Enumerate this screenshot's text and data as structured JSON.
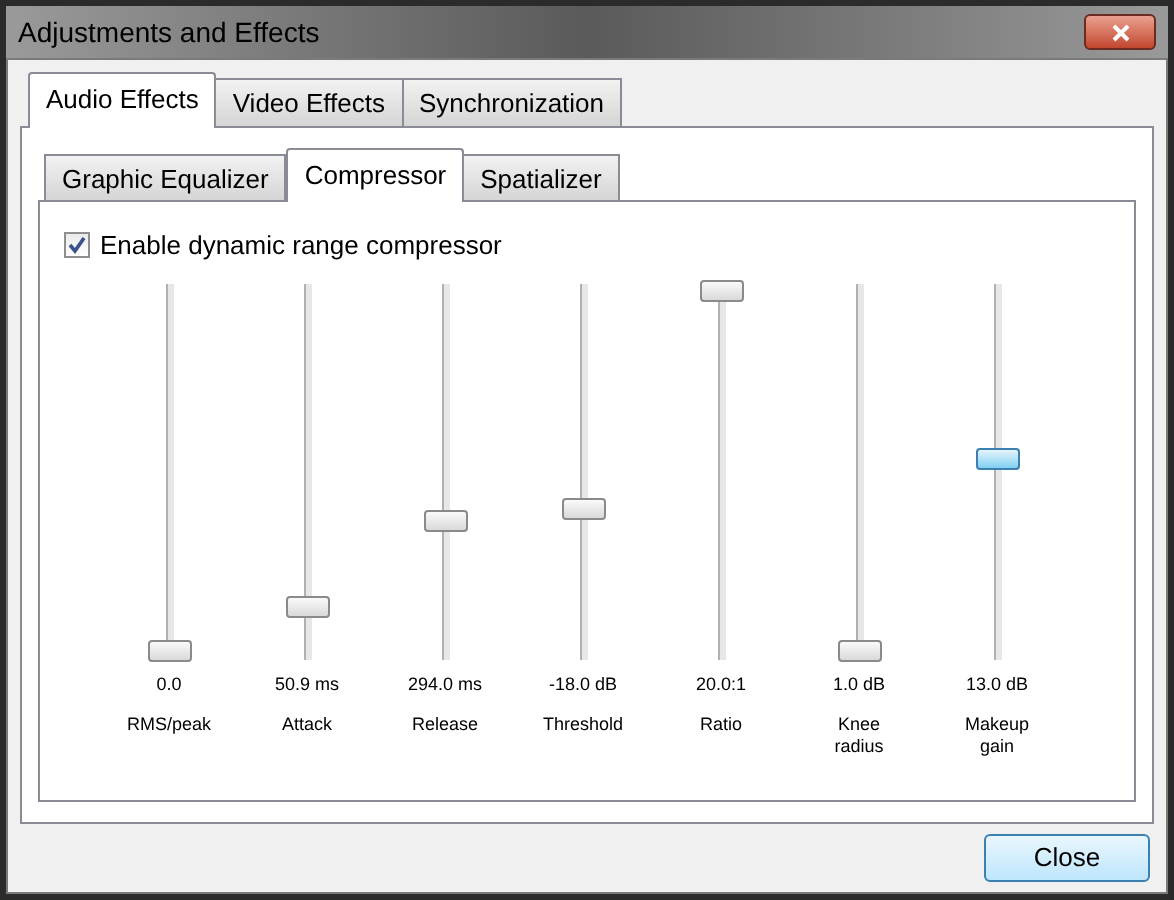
{
  "window": {
    "title": "Adjustments and Effects"
  },
  "tabs": [
    {
      "label": "Audio Effects",
      "selected": true
    },
    {
      "label": "Video Effects",
      "selected": false
    },
    {
      "label": "Synchronization",
      "selected": false
    }
  ],
  "subtabs": [
    {
      "label": "Graphic Equalizer",
      "selected": false
    },
    {
      "label": "Compressor",
      "selected": true
    },
    {
      "label": "Spatializer",
      "selected": false
    }
  ],
  "enable": {
    "label": "Enable dynamic range compressor",
    "checked": true
  },
  "sliders": [
    {
      "reading": "0.0",
      "name": "RMS/peak",
      "level": 0,
      "focused": false
    },
    {
      "reading": "50.9 ms",
      "name": "Attack",
      "level": 0.12,
      "focused": false
    },
    {
      "reading": "294.0 ms",
      "name": "Release",
      "level": 0.36,
      "focused": false
    },
    {
      "reading": "-18.0 dB",
      "name": "Threshold",
      "level": 0.39,
      "focused": false
    },
    {
      "reading": "20.0:1",
      "name": "Ratio",
      "level": 1,
      "focused": false
    },
    {
      "reading": "1.0 dB",
      "name": "Knee radius",
      "level": 0,
      "focused": false
    },
    {
      "reading": "13.0 dB",
      "name": "Makeup gain",
      "level": 0.53,
      "focused": true
    }
  ],
  "buttons": [
    {
      "label": "Close"
    }
  ]
}
